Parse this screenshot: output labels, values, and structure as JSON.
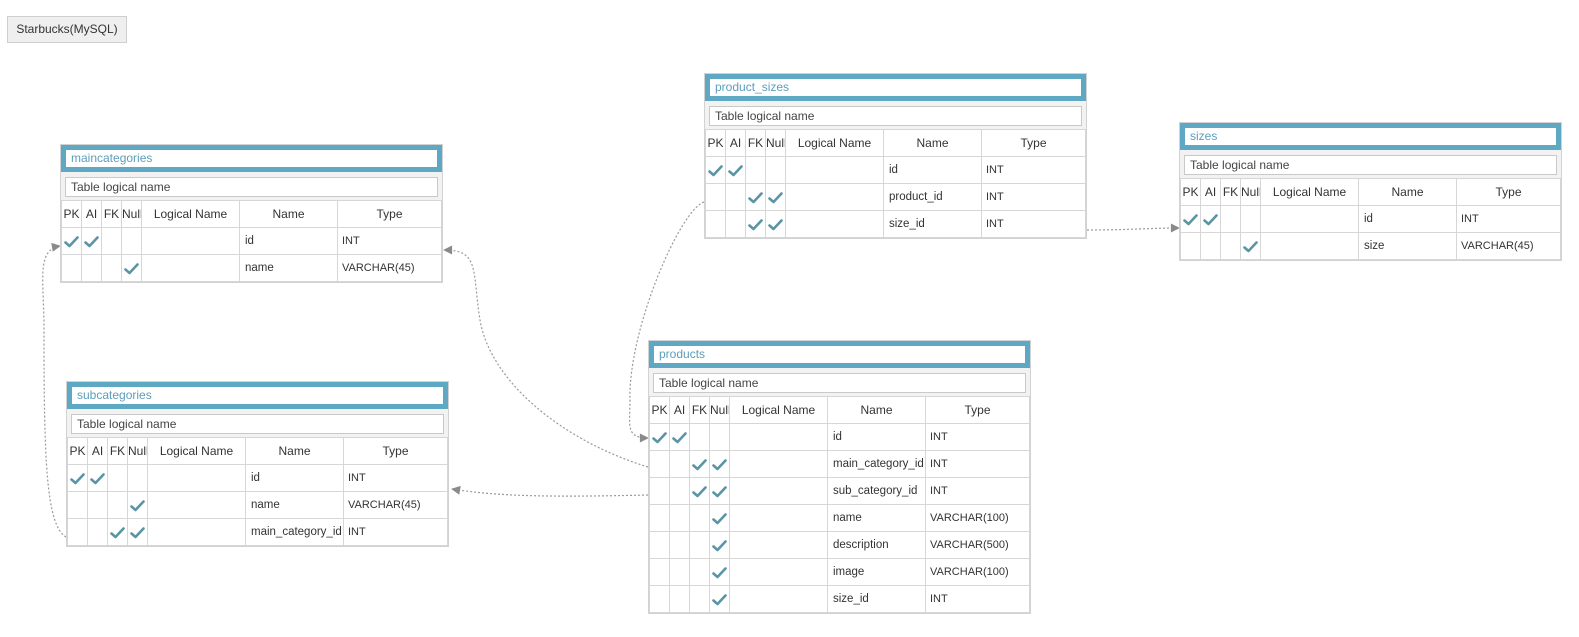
{
  "diagram_title": "Starbucks(MySQL)",
  "colors": {
    "accent": "#5ea8c3",
    "check": "#5a95a6",
    "connector": "#8a8a8a"
  },
  "column_headers": {
    "pk": "PK",
    "ai": "AI",
    "fk": "FK",
    "null": "Null",
    "logical": "Logical Name",
    "name": "Name",
    "type": "Type"
  },
  "tables": {
    "maincategories": {
      "name": "maincategories",
      "logical_placeholder": "Table logical name",
      "rows": [
        {
          "pk": true,
          "ai": true,
          "fk": false,
          "nullable": false,
          "logical": "",
          "name": "id",
          "type": "INT"
        },
        {
          "pk": false,
          "ai": false,
          "fk": false,
          "nullable": true,
          "logical": "",
          "name": "name",
          "type": "VARCHAR(45)"
        }
      ]
    },
    "subcategories": {
      "name": "subcategories",
      "logical_placeholder": "Table logical name",
      "rows": [
        {
          "pk": true,
          "ai": true,
          "fk": false,
          "nullable": false,
          "logical": "",
          "name": "id",
          "type": "INT"
        },
        {
          "pk": false,
          "ai": false,
          "fk": false,
          "nullable": true,
          "logical": "",
          "name": "name",
          "type": "VARCHAR(45)"
        },
        {
          "pk": false,
          "ai": false,
          "fk": true,
          "nullable": true,
          "logical": "",
          "name": "main_category_id",
          "type": "INT"
        }
      ]
    },
    "product_sizes": {
      "name": "product_sizes",
      "logical_placeholder": "Table logical name",
      "rows": [
        {
          "pk": true,
          "ai": true,
          "fk": false,
          "nullable": false,
          "logical": "",
          "name": "id",
          "type": "INT"
        },
        {
          "pk": false,
          "ai": false,
          "fk": true,
          "nullable": true,
          "logical": "",
          "name": "product_id",
          "type": "INT"
        },
        {
          "pk": false,
          "ai": false,
          "fk": true,
          "nullable": true,
          "logical": "",
          "name": "size_id",
          "type": "INT"
        }
      ]
    },
    "sizes": {
      "name": "sizes",
      "logical_placeholder": "Table logical name",
      "rows": [
        {
          "pk": true,
          "ai": true,
          "fk": false,
          "nullable": false,
          "logical": "",
          "name": "id",
          "type": "INT"
        },
        {
          "pk": false,
          "ai": false,
          "fk": false,
          "nullable": true,
          "logical": "",
          "name": "size",
          "type": "VARCHAR(45)"
        }
      ]
    },
    "products": {
      "name": "products",
      "logical_placeholder": "Table logical name",
      "rows": [
        {
          "pk": true,
          "ai": true,
          "fk": false,
          "nullable": false,
          "logical": "",
          "name": "id",
          "type": "INT"
        },
        {
          "pk": false,
          "ai": false,
          "fk": true,
          "nullable": true,
          "logical": "",
          "name": "main_category_id",
          "type": "INT"
        },
        {
          "pk": false,
          "ai": false,
          "fk": true,
          "nullable": true,
          "logical": "",
          "name": "sub_category_id",
          "type": "INT"
        },
        {
          "pk": false,
          "ai": false,
          "fk": false,
          "nullable": true,
          "logical": "",
          "name": "name",
          "type": "VARCHAR(100)"
        },
        {
          "pk": false,
          "ai": false,
          "fk": false,
          "nullable": true,
          "logical": "",
          "name": "description",
          "type": "VARCHAR(500)"
        },
        {
          "pk": false,
          "ai": false,
          "fk": false,
          "nullable": true,
          "logical": "",
          "name": "image",
          "type": "VARCHAR(100)"
        },
        {
          "pk": false,
          "ai": false,
          "fk": false,
          "nullable": true,
          "logical": "",
          "name": "size_id",
          "type": "INT"
        }
      ]
    }
  }
}
